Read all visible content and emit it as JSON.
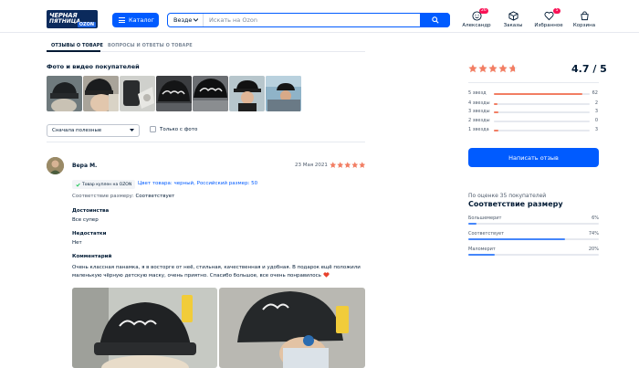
{
  "header": {
    "logo_line1": "ЧЕРНАЯ",
    "logo_line2": "ПЯТНИЦА",
    "logo_brand": "OZON",
    "catalog_label": "Каталог",
    "search_scope": "Везде",
    "search_placeholder": "Искать на Ozon",
    "nav": [
      {
        "label": "Александр",
        "icon": "profile-icon",
        "badge": "26"
      },
      {
        "label": "Заказы",
        "icon": "box-icon",
        "badge": ""
      },
      {
        "label": "Избранное",
        "icon": "heart-icon",
        "badge": "5"
      },
      {
        "label": "Корзина",
        "icon": "cart-icon",
        "badge": ""
      }
    ]
  },
  "tabs": [
    {
      "label": "ОТЗЫВЫ О ТОВАРЕ",
      "active": true
    },
    {
      "label": "ВОПРОСЫ И ОТВЕТЫ О ТОВАРЕ",
      "active": false
    }
  ],
  "photos_title": "Фото и видео покупателей",
  "filters": {
    "sort_value": "Сначала полезные",
    "only_photo_label": "Только с фото"
  },
  "review": {
    "author": "Вера М.",
    "date": "23 Мая 2021",
    "rating": 5,
    "purchase_badge": "Товар куплен на OZON",
    "variant": "Цвет товара: черный, Российский размер: 50",
    "fit_label": "Соответствие размеру:",
    "fit_value": "Соответствует",
    "pros_label": "Достоинства",
    "pros_value": "Все супер",
    "cons_label": "Недостатки",
    "cons_value": "Нет",
    "comment_label": "Комментарий",
    "comment_text": "Очень классная панамка, я в восторге от неё, стильная, качественная и удобная. В подарок ещё положили маленькую чёрную детскую маску, очень приятно. Спасибо большое, все очень понравилось"
  },
  "rating_summary": {
    "score": "4.7 / 5",
    "stars": 4.7,
    "rows": [
      {
        "label": "5 звезд",
        "count": "62",
        "fraction": 0.92
      },
      {
        "label": "4 звезды",
        "count": "2",
        "fraction": 0.04
      },
      {
        "label": "3 звезды",
        "count": "3",
        "fraction": 0.05
      },
      {
        "label": "2 звезды",
        "count": "0",
        "fraction": 0.0
      },
      {
        "label": "1 звезда",
        "count": "3",
        "fraction": 0.05
      }
    ],
    "write_button": "Написать отзыв"
  },
  "size_fit": {
    "subtitle": "По оценке 35 покупателей",
    "title": "Соответствие размеру",
    "rows": [
      {
        "label": "Большемерит",
        "pct": "6%",
        "fraction": 0.06
      },
      {
        "label": "Соответствует",
        "pct": "74%",
        "fraction": 0.74
      },
      {
        "label": "Маломерит",
        "pct": "20%",
        "fraction": 0.2
      }
    ]
  },
  "colors": {
    "accent": "#005bff",
    "star": "#f27e63",
    "text": "#001a34",
    "badge": "#f91155"
  }
}
